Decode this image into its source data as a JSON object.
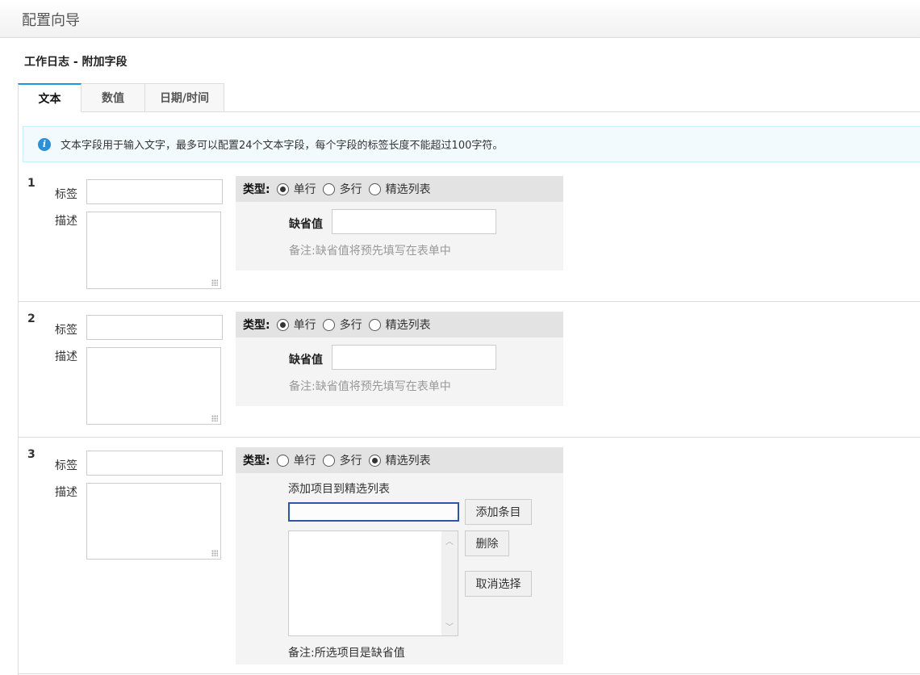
{
  "header": {
    "title": "配置向导"
  },
  "page_title": "工作日志 - 附加字段",
  "tabs": [
    {
      "label": "文本"
    },
    {
      "label": "数值"
    },
    {
      "label": "日期/时间"
    }
  ],
  "info": {
    "icon": "info-icon",
    "text": "文本字段用于输入文字，最多可以配置24个文本字段，每个字段的标签长度不能超过100字符。"
  },
  "labels": {
    "label": "标签",
    "description": "描述",
    "type": "类型:",
    "single": "单行",
    "multi": "多行",
    "picklist": "精选列表",
    "default": "缺省值",
    "default_note": "备注:缺省值将预先填写在表单中",
    "add_to_list": "添加项目到精选列表",
    "add_item": "添加条目",
    "delete": "删除",
    "deselect": "取消选择",
    "picklist_note": "备注:所选项目是缺省值"
  },
  "fields": [
    {
      "number": "1",
      "type": "单行",
      "label_value": "",
      "description_value": "",
      "default_value": ""
    },
    {
      "number": "2",
      "type": "单行",
      "label_value": "",
      "description_value": "",
      "default_value": ""
    },
    {
      "number": "3",
      "type": "精选列表",
      "label_value": "",
      "description_value": "",
      "picklist_items": []
    }
  ],
  "colors": {
    "accent": "#1a9be0",
    "info_bg": "#f3fafe",
    "focus": "#2f56a6"
  }
}
